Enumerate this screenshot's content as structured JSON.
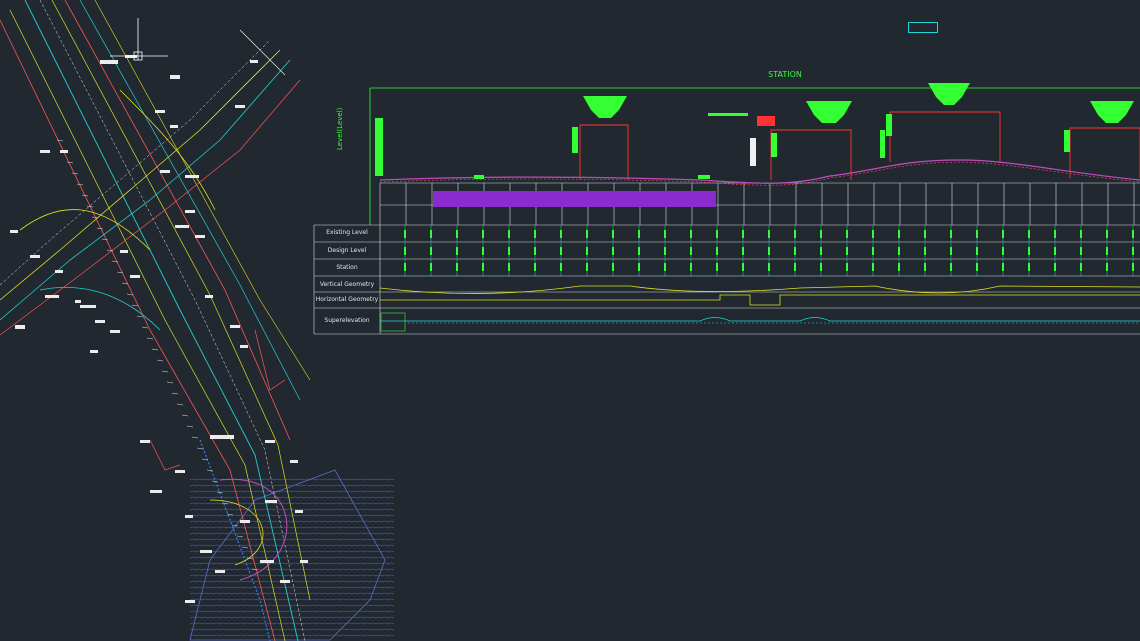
{
  "profile": {
    "title": "STATION",
    "vertical_axis_label": "Level(Level)",
    "row_labels": [
      "Existing Level",
      "Design Level",
      "Station",
      "Vertical Geometry",
      "Horizontal Geometry",
      "Superelevation"
    ],
    "colors": {
      "background": "#212830",
      "grid": "#d8dde3",
      "axis": "#33ff33",
      "structure": "#ff3333",
      "alignment": "#c04dc0",
      "geometry": "#e0e020",
      "text_cyan": "#1fd6d6"
    }
  },
  "plan_view": {
    "north_indicator": "crosshair-cursor",
    "hatch": "water-hatch"
  }
}
